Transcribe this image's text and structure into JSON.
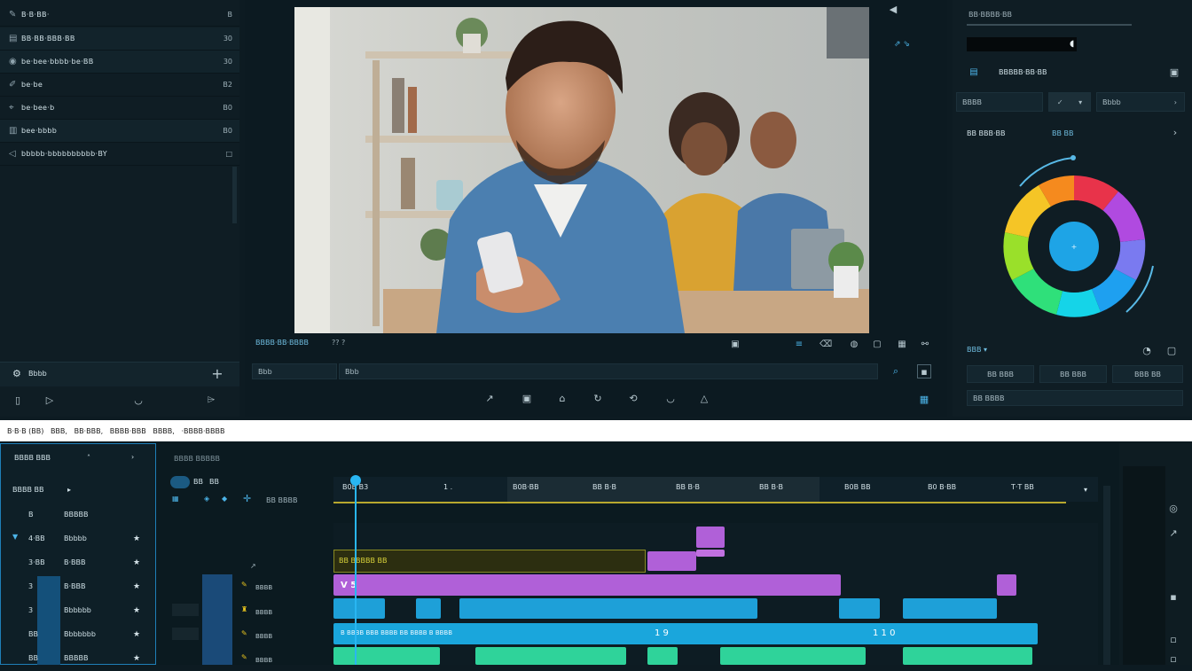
{
  "media_list": {
    "items": [
      {
        "label": "B·B·BB·",
        "count": "B"
      },
      {
        "label": "BB·BB·BBB·BB",
        "count": "30"
      },
      {
        "label": "be·bee·bbbb·be·BB",
        "count": "30"
      },
      {
        "label": "be·be",
        "count": "B2"
      },
      {
        "label": "be·bee·b",
        "count": "B0"
      },
      {
        "label": "bee·bbbb",
        "count": "B0"
      },
      {
        "label": "bbbbb·bbbbbbbbbb·BY",
        "count": "□"
      }
    ],
    "add_label": "Bbbb",
    "add_icon": "+"
  },
  "viewer": {
    "timecode": "BBBB·BB·BBBB",
    "speed": "?? ?",
    "search_placeholder": "Bbb",
    "field_text": "Bbb"
  },
  "inspector": {
    "title": "BB·BBBB·BB",
    "section_label": "BBBBB·BB·BB",
    "dropdown_left": "BBBB",
    "dropdown_right": "Bbbb",
    "color_label": "BB BBB·BB",
    "color_value": "BB BB",
    "mode_label": "BBB ▾",
    "buttons": [
      "BB BBB",
      "BB BBB",
      "BBB BB"
    ],
    "footer_label": "BB BBBB"
  },
  "status_bar": {
    "text": "B·B·B (BB)   BBB,   BB·BBB,   BBBB·BBB   BBBB,   ·BBBB·BBBB"
  },
  "timeline": {
    "left_header": "BBBB BBB",
    "left_subheader": "BBBB BB",
    "left_rows": [
      {
        "num": "B",
        "label": "BBBBB"
      },
      {
        "num": "4·BB",
        "label": "Bbbbb"
      },
      {
        "num": "3·BB",
        "label": "B·BBB"
      },
      {
        "num": "3",
        "label": "B·BBB"
      },
      {
        "num": "3",
        "label": "Bbbbbb"
      },
      {
        "num": "BB",
        "label": "Bbbbbbb"
      },
      {
        "num": "BB",
        "label": "BBBBB"
      }
    ],
    "tracks_header": "BBBB BBBBB",
    "tool_labels": [
      "BB",
      "BB",
      "BB BBBB"
    ],
    "ruler_ticks": [
      "B0B B3",
      "1 .",
      "B0B·BB",
      "BB B·B",
      "BB B·B",
      "BB B·B",
      "B0B BB",
      "B0 B·BB",
      "T·T BB"
    ],
    "track_labels": [
      "BBBB",
      "BBBB",
      "BBBB",
      "BBBB"
    ],
    "clip_title": "BB BBBBB BB",
    "clip_v5": "V 5",
    "audio_text": "B BBBB BBB BBBB BB BBBB B BBBB",
    "num_marks": [
      "1  9",
      "1  1  0"
    ]
  },
  "colors": {
    "accent": "#1fa3e0",
    "purple": "#b060d8",
    "blue": "#1ea0d8",
    "green": "#2fd39a",
    "olive": "#3a3a10"
  }
}
